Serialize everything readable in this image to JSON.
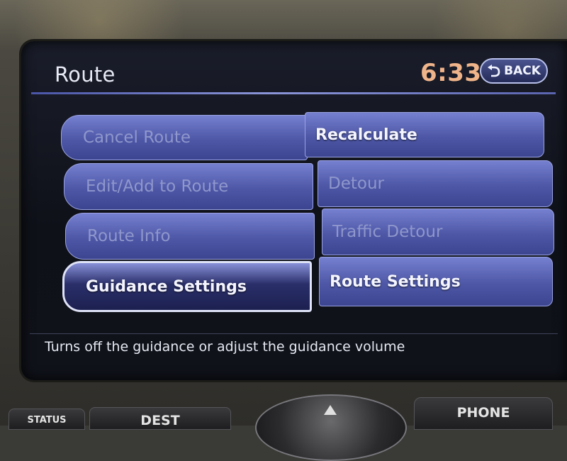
{
  "screen": {
    "title": "Route",
    "clock": "6:33",
    "back_label": "BACK"
  },
  "menu": {
    "left": [
      {
        "label": "Cancel Route",
        "enabled": false
      },
      {
        "label": "Edit/Add to Route",
        "enabled": false
      },
      {
        "label": "Route Info",
        "enabled": false
      },
      {
        "label": "Guidance Settings",
        "enabled": true,
        "selected": true
      }
    ],
    "right": [
      {
        "label": "Recalculate",
        "enabled": true
      },
      {
        "label": "Detour",
        "enabled": false
      },
      {
        "label": "Traffic Detour",
        "enabled": false
      },
      {
        "label": "Route Settings",
        "enabled": true
      }
    ]
  },
  "help_text": "Turns off the guidance or adjust the guidance volume",
  "hardware": {
    "status_label": "STATUS",
    "dest_label": "DEST",
    "phone_label": "PHONE"
  },
  "icons": {
    "back": "back-arrow-icon",
    "up": "up-arrow-icon"
  },
  "colors": {
    "clock": "#f0b48a",
    "item_fill": "#4d57a6",
    "item_disabled_text": "#8f97cc",
    "selected_border": "#dfe3f8"
  }
}
